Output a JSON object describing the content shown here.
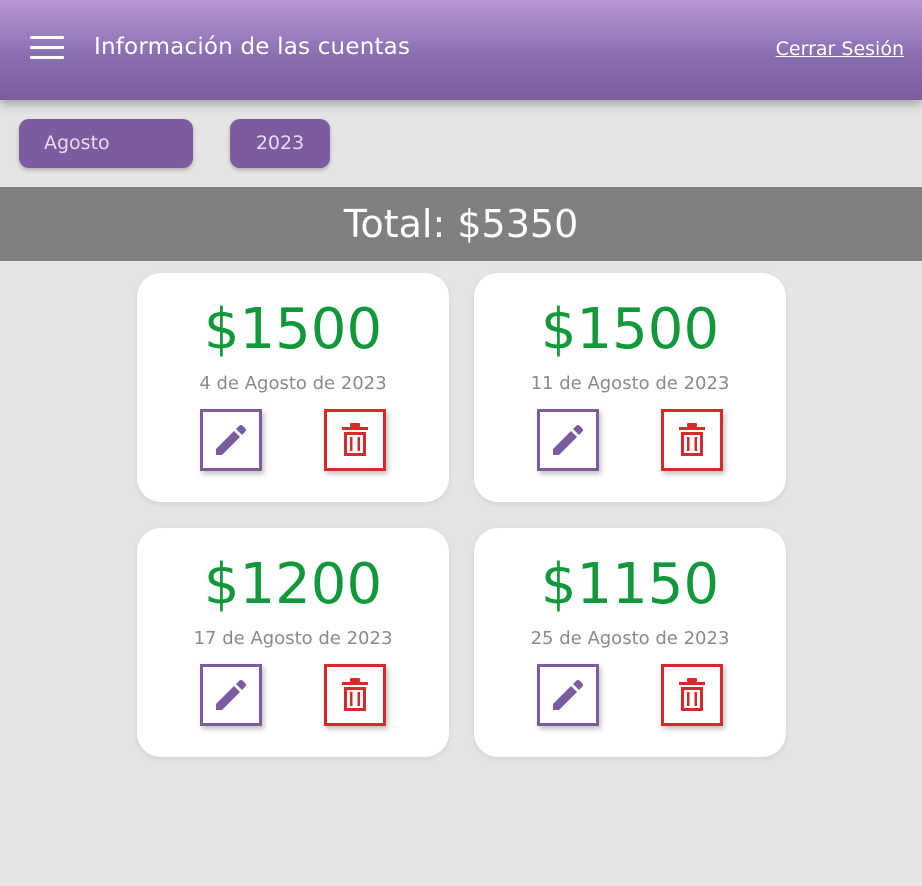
{
  "header": {
    "title": "Información de las cuentas",
    "logout_label": "Cerrar Sesión",
    "menu_icon": "hamburger-menu-icon"
  },
  "filters": {
    "month": "Agosto",
    "year": "2023"
  },
  "total": {
    "label": "Total: $5350"
  },
  "colors": {
    "header_gradient": [
      "#b898d4",
      "#7a5f9f"
    ],
    "filter_bg": "#7b5c9e",
    "total_bar_bg": "#808080",
    "amount_green": "#11983a",
    "edit_purple": "#7b5c9e",
    "delete_red": "#d62a2a",
    "page_bg": "#e5e5e5"
  },
  "cards": [
    {
      "amount": "$1500",
      "date": "4 de Agosto de 2023",
      "edit_icon": "pencil-icon",
      "delete_icon": "trash-icon"
    },
    {
      "amount": "$1500",
      "date": "11 de Agosto de 2023",
      "edit_icon": "pencil-icon",
      "delete_icon": "trash-icon"
    },
    {
      "amount": "$1200",
      "date": "17 de Agosto de 2023",
      "edit_icon": "pencil-icon",
      "delete_icon": "trash-icon"
    },
    {
      "amount": "$1150",
      "date": "25 de Agosto de 2023",
      "edit_icon": "pencil-icon",
      "delete_icon": "trash-icon"
    }
  ]
}
